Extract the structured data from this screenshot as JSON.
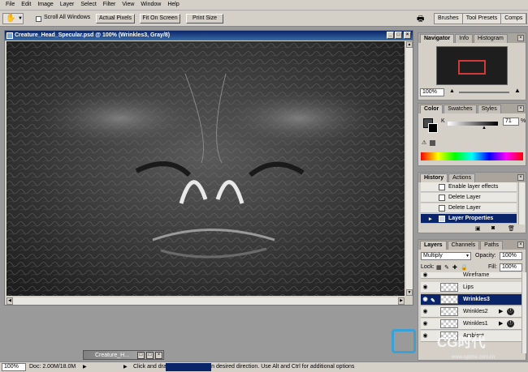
{
  "menu": [
    "File",
    "Edit",
    "Image",
    "Layer",
    "Select",
    "Filter",
    "View",
    "Window",
    "Help"
  ],
  "options": {
    "scroll_all_label": "Scroll All Windows",
    "actual_pixels": "Actual Pixels",
    "fit_on_screen": "Fit On Screen",
    "print_size": "Print Size"
  },
  "wells": [
    "Brushes",
    "Tool Presets",
    "Comps"
  ],
  "document": {
    "title": "Creature_Head_Specular.psd @ 100% (Wrinkles3, Gray/8)"
  },
  "navigator": {
    "tabs": [
      "Navigator",
      "Info",
      "Histogram"
    ],
    "zoom": "100%"
  },
  "color": {
    "tabs": [
      "Color",
      "Swatches",
      "Styles"
    ],
    "channel": "K",
    "value": "71",
    "unit": "%"
  },
  "history": {
    "tabs": [
      "History",
      "Actions"
    ],
    "items": [
      "Enable layer effects",
      "Delete Layer",
      "Delete Layer",
      "Layer Properties"
    ],
    "selected_index": 3
  },
  "layers": {
    "tabs": [
      "Layers",
      "Channels",
      "Paths"
    ],
    "blend_mode": "Multiply",
    "opacity_label": "Opacity:",
    "opacity": "100%",
    "lock_label": "Lock:",
    "fill_label": "Fill:",
    "fill": "100%",
    "items": [
      "Wireframe",
      "Lips",
      "Wrinkles3",
      "Wrinkles2",
      "Wrinkles1",
      "Ambient"
    ],
    "selected_index": 2
  },
  "status": {
    "zoom": "100%",
    "doc_size": "Doc: 2.00M/18.0M",
    "hint": "Click and drag to move image in desired direction.  Use Alt and Ctrl for additional options"
  },
  "mini_window": {
    "title": "Creature_H..."
  },
  "watermark": {
    "brand": "CG时代",
    "url": "www.cgtime.com.cn"
  },
  "colors": {
    "titlebar": "#0a246a",
    "panel": "#d4d0c8",
    "selected": "#0a246a",
    "swatch_red": "#d23a3a"
  }
}
